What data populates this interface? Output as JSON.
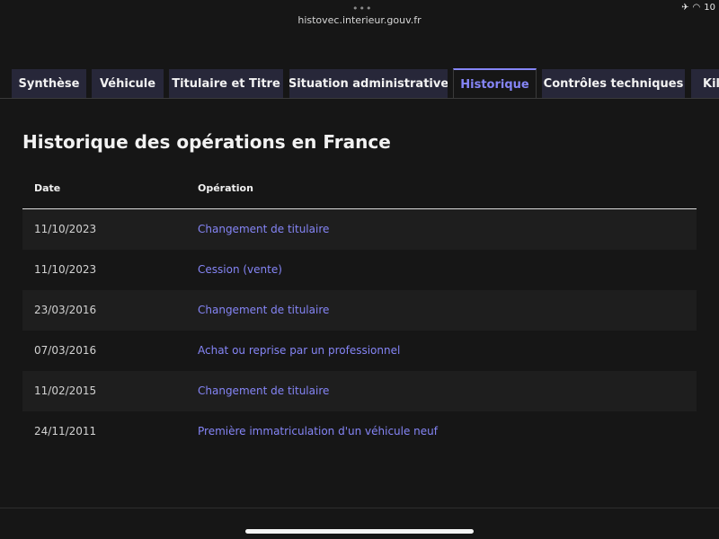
{
  "browser": {
    "url": "histovec.interieur.gouv.fr",
    "dots": "•••",
    "status": {
      "airplane": "✈",
      "wifi": "◠",
      "time_fragment": "10"
    }
  },
  "tabs": [
    {
      "label": "Synthèse",
      "active": false
    },
    {
      "label": "Véhicule",
      "active": false
    },
    {
      "label": "Titulaire et Titre",
      "active": false
    },
    {
      "label": "Situation administrative",
      "active": false
    },
    {
      "label": "Historique",
      "active": true
    },
    {
      "label": "Contrôles techniques",
      "active": false
    },
    {
      "label": "Kilo",
      "active": false
    }
  ],
  "page": {
    "title": "Historique des opérations en France"
  },
  "table": {
    "headers": {
      "date": "Date",
      "operation": "Opération"
    },
    "rows": [
      {
        "date": "11/10/2023",
        "operation": "Changement de titulaire"
      },
      {
        "date": "11/10/2023",
        "operation": "Cession (vente)"
      },
      {
        "date": "23/03/2016",
        "operation": "Changement de titulaire"
      },
      {
        "date": "07/03/2016",
        "operation": "Achat ou reprise par un professionnel"
      },
      {
        "date": "11/02/2015",
        "operation": "Changement de titulaire"
      },
      {
        "date": "24/11/2011",
        "operation": "Première immatriculation d'un véhicule neuf"
      }
    ]
  },
  "colors": {
    "accent": "#8585f6",
    "tab_bg": "#272739",
    "background": "#161616",
    "row_alt": "#1e1e1e"
  }
}
